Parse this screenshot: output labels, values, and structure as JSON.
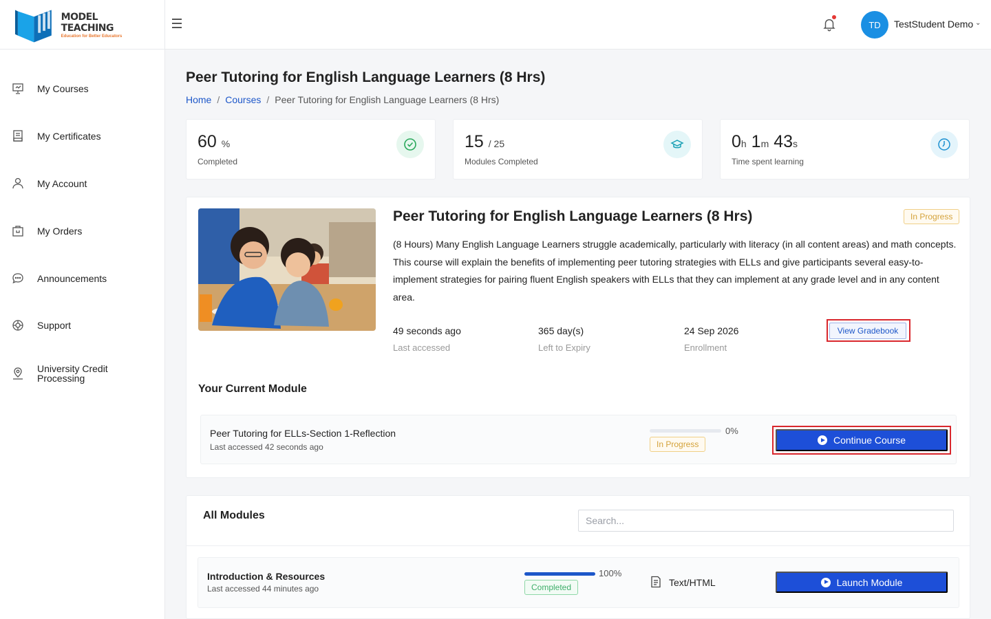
{
  "brand": {
    "name": "MODEL TEACHING",
    "tagline": "Education for Better Educators"
  },
  "header": {
    "user_initials": "TD",
    "user_name": "TestStudent Demo",
    "caret": "⌄"
  },
  "sidebar": {
    "items": [
      {
        "label": "My Courses",
        "icon": "presentation-board-icon"
      },
      {
        "label": "My Certificates",
        "icon": "certificate-icon"
      },
      {
        "label": "My Account",
        "icon": "user-icon"
      },
      {
        "label": "My Orders",
        "icon": "shopping-bag-icon"
      },
      {
        "label": "Announcements",
        "icon": "chat-bubble-icon"
      },
      {
        "label": "Support",
        "icon": "lifebuoy-icon"
      },
      {
        "label": "University Credit Processing",
        "icon": "location-badge-icon"
      }
    ]
  },
  "page": {
    "title": "Peer Tutoring for English Language Learners (8 Hrs)",
    "breadcrumb": {
      "home": "Home",
      "sep": "/",
      "courses": "Courses",
      "current": "Peer Tutoring for English Language Learners (8 Hrs)"
    }
  },
  "stats": {
    "completed": {
      "value": "60",
      "unit": "%",
      "caption": "Completed",
      "icon": "check-circle-icon"
    },
    "modules": {
      "value": "15",
      "total": "/ 25",
      "caption": "Modules Completed",
      "icon": "graduation-cap-icon"
    },
    "time": {
      "h": "0",
      "h_unit": "h",
      "m": "1",
      "m_unit": "m",
      "s": "43",
      "s_unit": "s",
      "caption": "Time spent learning",
      "icon": "clock-icon"
    }
  },
  "course": {
    "title": "Peer Tutoring for English Language Learners (8 Hrs)",
    "status": "In Progress",
    "description": "(8 Hours)  Many English Language Learners struggle academically, particularly with literacy (in all content areas) and math concepts. This course will explain the benefits of implementing peer tutoring strategies with ELLs and give participants several easy-to-implement strategies for pairing fluent English speakers with ELLs that they can implement at any grade level and in any content area.",
    "last_accessed": {
      "value": "49 seconds ago",
      "label": "Last accessed"
    },
    "expiry": {
      "value": "365 day(s)",
      "label": "Left to Expiry"
    },
    "enrollment": {
      "value": "24 Sep 2026",
      "label": "Enrollment"
    },
    "gradebook_label": "View Gradebook"
  },
  "current_module": {
    "heading": "Your Current Module",
    "name": "Peer Tutoring for ELLs-Section 1-Reflection",
    "last_accessed": "Last accessed 42 seconds ago",
    "progress": 0,
    "progress_label": "0%",
    "status": "In Progress",
    "button_label": "Continue Course"
  },
  "all_modules": {
    "heading": "All Modules",
    "search_placeholder": "Search...",
    "rows": [
      {
        "name": "Introduction & Resources",
        "last_accessed": "Last accessed 44 minutes ago",
        "progress": 100,
        "progress_label": "100%",
        "status": "Completed",
        "type": "Text/HTML",
        "type_icon": "document-icon",
        "button_label": "Launch Module"
      }
    ]
  },
  "colors": {
    "primary": "#1d4fd8",
    "link": "#1d57c9",
    "avatar": "#1a8fe3",
    "highlight": "#d9262c",
    "warning": "#d4a23a",
    "success": "#3fae6a"
  }
}
